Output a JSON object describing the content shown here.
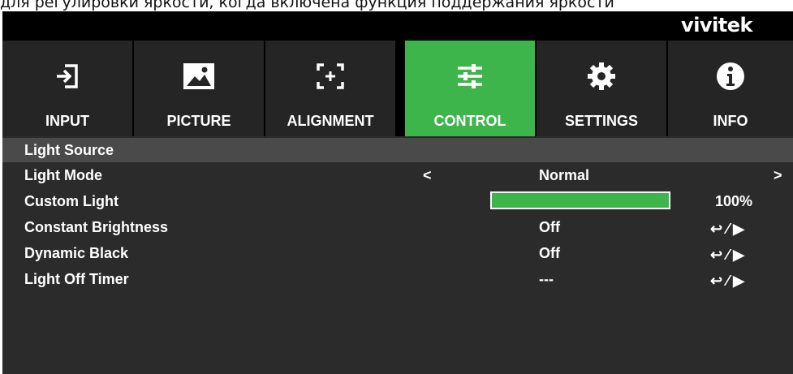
{
  "caption": "для регулировки яркости, когда включена функция поддержания яркости",
  "brand": {
    "logo": "vivitek"
  },
  "tabs": [
    {
      "label": "INPUT",
      "icon": "input-icon"
    },
    {
      "label": "PICTURE",
      "icon": "picture-icon"
    },
    {
      "label": "ALIGNMENT",
      "icon": "alignment-icon"
    },
    {
      "label": "CONTROL",
      "icon": "control-sliders-icon",
      "active": true
    },
    {
      "label": "SETTINGS",
      "icon": "gear-icon"
    },
    {
      "label": "INFO",
      "icon": "info-icon"
    }
  ],
  "menu": {
    "section": "Light Source",
    "rows": [
      {
        "label": "Light Mode",
        "value": "Normal",
        "left_arrow": "<",
        "right_arrow": ">"
      },
      {
        "label": "Custom Light",
        "level": 1.0,
        "percent": "100%"
      },
      {
        "label": "Constant Brightness",
        "value": "Off",
        "action": "↩ ⁄ ▶"
      },
      {
        "label": "Dynamic Black",
        "value": "Off",
        "action": "↩ ⁄ ▶"
      },
      {
        "label": "Light Off Timer",
        "value": "---",
        "action": "↩ ⁄ ▶"
      }
    ]
  },
  "colors": {
    "accent": "#3db54a",
    "background": "#2b2b2b",
    "header": "#4a4a4a"
  }
}
